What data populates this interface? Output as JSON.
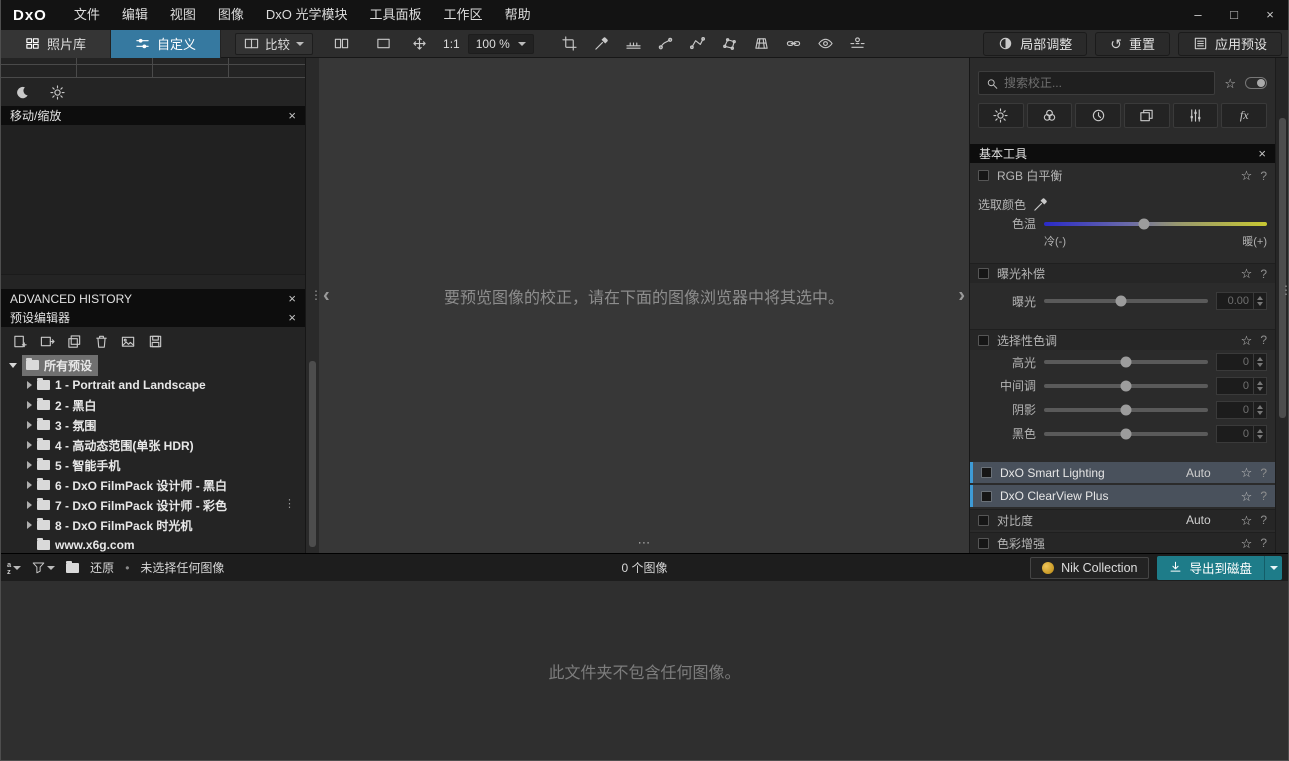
{
  "icons": {
    "star": "☆",
    "help": "?",
    "close": "×",
    "bullet": "•",
    "grip_v": "⋮",
    "grip_h": "⋯",
    "collapse_left": "‹",
    "collapse_right": "›",
    "minimize": "–",
    "maximize": "□",
    "reset_arrow": "↺",
    "fx": "fx"
  },
  "menubar": {
    "logo": "DxO",
    "items": [
      "文件",
      "编辑",
      "视图",
      "图像",
      "DxO 光学模块",
      "工具面板",
      "工作区",
      "帮助"
    ]
  },
  "toolbar": {
    "tabs": [
      "照片库",
      "自定义"
    ],
    "compare": "比较",
    "ratio": "1:1",
    "zoom": "100 %",
    "local_adjust": "局部调整",
    "reset": "重置",
    "apply_preset": "应用预设"
  },
  "left_panel": {
    "move_zoom_title": "移动/缩放",
    "history_title": "ADVANCED HISTORY",
    "preset_editor_title": "预设编辑器",
    "preset_root": "所有预设",
    "preset_items": [
      "1 - Portrait and Landscape",
      "2 - 黑白",
      "3 - 氛围",
      "4 - 高动态范围(单张 HDR)",
      "5 - 智能手机",
      "6 - DxO FilmPack 设计师 - 黑白",
      "7 - DxO FilmPack 设计师 - 彩色",
      "8 - DxO FilmPack 时光机",
      "www.x6g.com"
    ]
  },
  "viewer": {
    "hint": "要预览图像的校正，请在下面的图像浏览器中将其选中。"
  },
  "right_panel": {
    "search_placeholder": "搜索校正...",
    "palette_title": "基本工具",
    "white_balance": {
      "title": "RGB 白平衡",
      "pick_color": "选取颜色",
      "temp_label": "色温",
      "cold": "冷(-)",
      "warm": "暖(+)"
    },
    "exposure": {
      "title": "曝光补偿",
      "label": "曝光",
      "value": "0.00"
    },
    "selective_tone": {
      "title": "选择性色调",
      "rows": [
        {
          "label": "高光",
          "value": "0"
        },
        {
          "label": "中间调",
          "value": "0"
        },
        {
          "label": "阴影",
          "value": "0"
        },
        {
          "label": "黑色",
          "value": "0"
        }
      ]
    },
    "smart_lighting": {
      "title": "DxO Smart Lighting",
      "mode": "Auto"
    },
    "clearview": {
      "title": "DxO ClearView Plus"
    },
    "contrast": {
      "title": "对比度",
      "mode": "Auto"
    },
    "color_accent": {
      "title": "色彩增强"
    }
  },
  "statusbar": {
    "restore": "还原",
    "selection": "未选择任何图像",
    "count": "0 个图像",
    "nik": "Nik Collection",
    "export": "导出到磁盘"
  },
  "browser": {
    "empty": "此文件夹不包含任何图像。"
  },
  "colors": {
    "active_tab": "#3679a0",
    "export_button": "#1e7c89",
    "highlight_border": "#3e9bd6",
    "temp_gradient_start": "#2a2ac8",
    "temp_gradient_end": "#c8c832"
  }
}
